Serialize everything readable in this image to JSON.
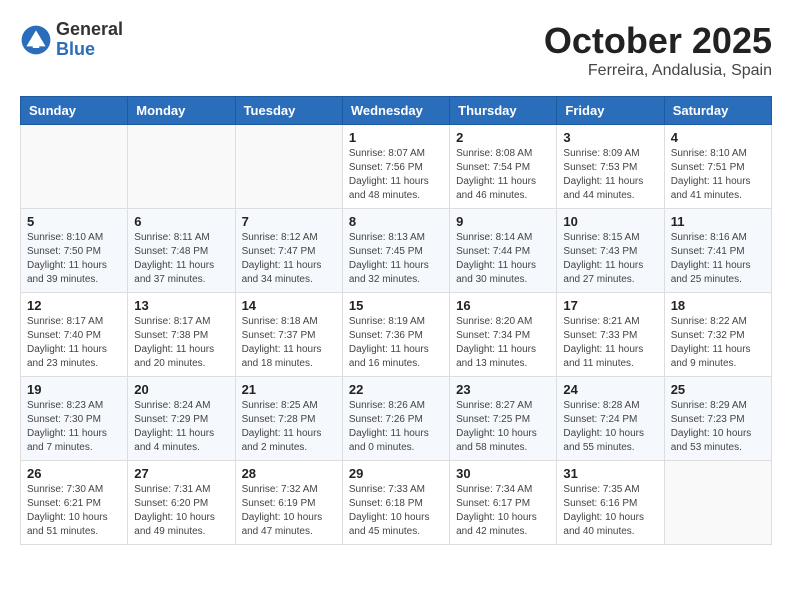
{
  "header": {
    "logo_general": "General",
    "logo_blue": "Blue",
    "month_title": "October 2025",
    "location": "Ferreira, Andalusia, Spain"
  },
  "days_of_week": [
    "Sunday",
    "Monday",
    "Tuesday",
    "Wednesday",
    "Thursday",
    "Friday",
    "Saturday"
  ],
  "weeks": [
    [
      {
        "day": "",
        "info": ""
      },
      {
        "day": "",
        "info": ""
      },
      {
        "day": "",
        "info": ""
      },
      {
        "day": "1",
        "info": "Sunrise: 8:07 AM\nSunset: 7:56 PM\nDaylight: 11 hours and 48 minutes."
      },
      {
        "day": "2",
        "info": "Sunrise: 8:08 AM\nSunset: 7:54 PM\nDaylight: 11 hours and 46 minutes."
      },
      {
        "day": "3",
        "info": "Sunrise: 8:09 AM\nSunset: 7:53 PM\nDaylight: 11 hours and 44 minutes."
      },
      {
        "day": "4",
        "info": "Sunrise: 8:10 AM\nSunset: 7:51 PM\nDaylight: 11 hours and 41 minutes."
      }
    ],
    [
      {
        "day": "5",
        "info": "Sunrise: 8:10 AM\nSunset: 7:50 PM\nDaylight: 11 hours and 39 minutes."
      },
      {
        "day": "6",
        "info": "Sunrise: 8:11 AM\nSunset: 7:48 PM\nDaylight: 11 hours and 37 minutes."
      },
      {
        "day": "7",
        "info": "Sunrise: 8:12 AM\nSunset: 7:47 PM\nDaylight: 11 hours and 34 minutes."
      },
      {
        "day": "8",
        "info": "Sunrise: 8:13 AM\nSunset: 7:45 PM\nDaylight: 11 hours and 32 minutes."
      },
      {
        "day": "9",
        "info": "Sunrise: 8:14 AM\nSunset: 7:44 PM\nDaylight: 11 hours and 30 minutes."
      },
      {
        "day": "10",
        "info": "Sunrise: 8:15 AM\nSunset: 7:43 PM\nDaylight: 11 hours and 27 minutes."
      },
      {
        "day": "11",
        "info": "Sunrise: 8:16 AM\nSunset: 7:41 PM\nDaylight: 11 hours and 25 minutes."
      }
    ],
    [
      {
        "day": "12",
        "info": "Sunrise: 8:17 AM\nSunset: 7:40 PM\nDaylight: 11 hours and 23 minutes."
      },
      {
        "day": "13",
        "info": "Sunrise: 8:17 AM\nSunset: 7:38 PM\nDaylight: 11 hours and 20 minutes."
      },
      {
        "day": "14",
        "info": "Sunrise: 8:18 AM\nSunset: 7:37 PM\nDaylight: 11 hours and 18 minutes."
      },
      {
        "day": "15",
        "info": "Sunrise: 8:19 AM\nSunset: 7:36 PM\nDaylight: 11 hours and 16 minutes."
      },
      {
        "day": "16",
        "info": "Sunrise: 8:20 AM\nSunset: 7:34 PM\nDaylight: 11 hours and 13 minutes."
      },
      {
        "day": "17",
        "info": "Sunrise: 8:21 AM\nSunset: 7:33 PM\nDaylight: 11 hours and 11 minutes."
      },
      {
        "day": "18",
        "info": "Sunrise: 8:22 AM\nSunset: 7:32 PM\nDaylight: 11 hours and 9 minutes."
      }
    ],
    [
      {
        "day": "19",
        "info": "Sunrise: 8:23 AM\nSunset: 7:30 PM\nDaylight: 11 hours and 7 minutes."
      },
      {
        "day": "20",
        "info": "Sunrise: 8:24 AM\nSunset: 7:29 PM\nDaylight: 11 hours and 4 minutes."
      },
      {
        "day": "21",
        "info": "Sunrise: 8:25 AM\nSunset: 7:28 PM\nDaylight: 11 hours and 2 minutes."
      },
      {
        "day": "22",
        "info": "Sunrise: 8:26 AM\nSunset: 7:26 PM\nDaylight: 11 hours and 0 minutes."
      },
      {
        "day": "23",
        "info": "Sunrise: 8:27 AM\nSunset: 7:25 PM\nDaylight: 10 hours and 58 minutes."
      },
      {
        "day": "24",
        "info": "Sunrise: 8:28 AM\nSunset: 7:24 PM\nDaylight: 10 hours and 55 minutes."
      },
      {
        "day": "25",
        "info": "Sunrise: 8:29 AM\nSunset: 7:23 PM\nDaylight: 10 hours and 53 minutes."
      }
    ],
    [
      {
        "day": "26",
        "info": "Sunrise: 7:30 AM\nSunset: 6:21 PM\nDaylight: 10 hours and 51 minutes."
      },
      {
        "day": "27",
        "info": "Sunrise: 7:31 AM\nSunset: 6:20 PM\nDaylight: 10 hours and 49 minutes."
      },
      {
        "day": "28",
        "info": "Sunrise: 7:32 AM\nSunset: 6:19 PM\nDaylight: 10 hours and 47 minutes."
      },
      {
        "day": "29",
        "info": "Sunrise: 7:33 AM\nSunset: 6:18 PM\nDaylight: 10 hours and 45 minutes."
      },
      {
        "day": "30",
        "info": "Sunrise: 7:34 AM\nSunset: 6:17 PM\nDaylight: 10 hours and 42 minutes."
      },
      {
        "day": "31",
        "info": "Sunrise: 7:35 AM\nSunset: 6:16 PM\nDaylight: 10 hours and 40 minutes."
      },
      {
        "day": "",
        "info": ""
      }
    ]
  ]
}
